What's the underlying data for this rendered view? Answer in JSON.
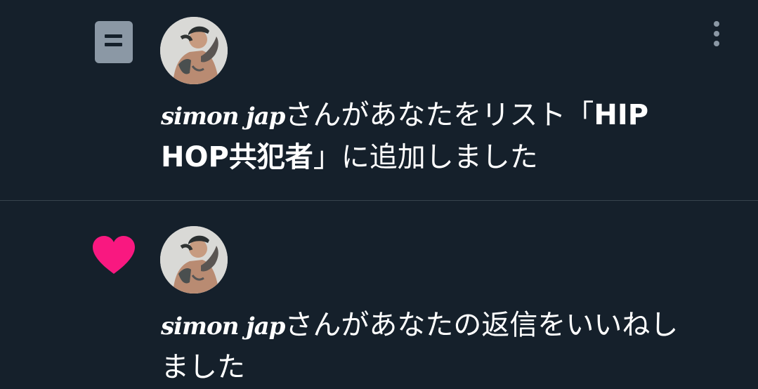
{
  "notifications": [
    {
      "type": "list-add",
      "icon": "list-icon",
      "avatar": "user-avatar",
      "user": "simon jap",
      "text_before": "さんがあなたをリスト「",
      "list_name": "HIP HOP共犯者",
      "text_after": "」に追加しました",
      "more_icon": "more-vertical-icon"
    },
    {
      "type": "like",
      "icon": "heart-icon",
      "avatar": "user-avatar",
      "user": "simon jap",
      "text": "さんがあなたの返信をいいねしました"
    }
  ],
  "colors": {
    "background": "#15202b",
    "divider": "#38444d",
    "list_icon": "#8b98a5",
    "heart": "#f91880",
    "text": "#ffffff"
  }
}
